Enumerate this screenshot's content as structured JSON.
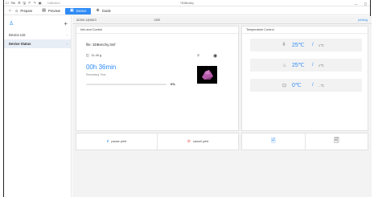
{
  "titlebar": {
    "file_label": "File",
    "calibration_label": "Calibration",
    "document_title": "*3DBenchy",
    "minimize_glyph": "—",
    "maximize_glyph": "◻"
  },
  "tabs": [
    {
      "label": "Prepare",
      "icon": "home-icon"
    },
    {
      "label": "Preview",
      "icon": "preview-icon"
    },
    {
      "label": "Device",
      "icon": "device-icon"
    },
    {
      "label": "Guide",
      "icon": "guide-icon"
    }
  ],
  "sidebar": {
    "items": [
      {
        "label": "Device List"
      },
      {
        "label": "Device Status"
      }
    ]
  },
  "device": {
    "id": "AD5M-1@8823",
    "type": "1355",
    "status": "printing"
  },
  "info": {
    "heading": "Info and Control",
    "file_name": "file: 3DBenchy.3mf",
    "weight": "11.49 g",
    "time_remaining": "00h 36min",
    "remaining_label": "Remaining Time",
    "progress": 0,
    "progress_text": "0%"
  },
  "temperature": {
    "heading": "Temperature Control",
    "rows": [
      {
        "icon": "nozzle-icon",
        "current": "25℃",
        "separator": "/",
        "target": "0℃"
      },
      {
        "icon": "bed-icon",
        "current": "25℃",
        "separator": "/",
        "target": "0℃"
      },
      {
        "icon": "chamber-icon",
        "current": "0℃",
        "separator": "/",
        "target": "--℃"
      }
    ]
  },
  "actions": {
    "pause_label": "pause print",
    "cancel_label": "cancel print"
  },
  "colors": {
    "accent": "#2f8cf6",
    "cancel": "#e9544f",
    "model": "#b45aa8"
  }
}
